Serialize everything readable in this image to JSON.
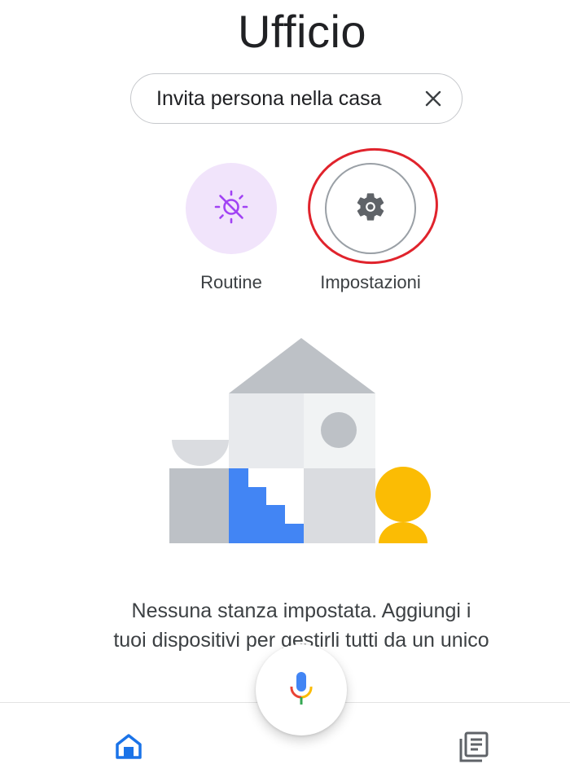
{
  "header": {
    "title": "Ufficio"
  },
  "invite_chip": {
    "label": "Invita persona nella casa",
    "close_icon": "close-icon"
  },
  "actions": [
    {
      "label": "Routine",
      "icon": "routine-sun-icon",
      "background": "#f1e4fb",
      "icon_color": "#a142f4"
    },
    {
      "label": "Impostazioni",
      "icon": "gear-icon",
      "background": "#ffffff",
      "icon_color": "#5f6368"
    }
  ],
  "annotation": {
    "color": "#e0232c"
  },
  "empty_state": {
    "illustration": "house-illustration",
    "message_line_1": "Nessuna stanza impostata. Aggiungi i",
    "message_line_2": "tuoi dispositivi per gestirli tutti da un unico"
  },
  "bottom_nav": {
    "items": [
      {
        "icon": "home-icon",
        "active": true,
        "color": "#1a73e8"
      },
      {
        "icon": "feed-icon",
        "active": false,
        "color": "#5f6368"
      }
    ],
    "fab_icon": "google-mic-icon"
  }
}
